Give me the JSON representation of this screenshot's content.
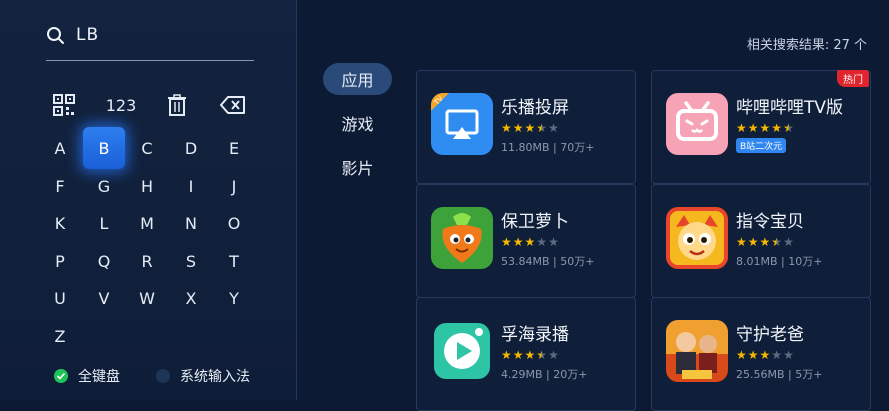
{
  "search": {
    "query": "LB"
  },
  "keyboard": {
    "number_toggle": "123",
    "rows": [
      [
        "A",
        "B",
        "C",
        "D",
        "E"
      ],
      [
        "F",
        "G",
        "H",
        "I",
        "J"
      ],
      [
        "K",
        "L",
        "M",
        "N",
        "O"
      ],
      [
        "P",
        "Q",
        "R",
        "S",
        "T"
      ],
      [
        "U",
        "V",
        "W",
        "X",
        "Y"
      ],
      [
        "Z"
      ]
    ],
    "selected_key": "B",
    "modes": [
      {
        "label": "全键盘",
        "selected": true
      },
      {
        "label": "系统输入法",
        "selected": false
      }
    ]
  },
  "categories": [
    {
      "label": "应用",
      "active": true
    },
    {
      "label": "游戏",
      "active": false
    },
    {
      "label": "影片",
      "active": false
    }
  ],
  "results": {
    "count_text": "相关搜索结果: 27 个"
  },
  "apps": [
    {
      "name": "乐播投屏",
      "rating": 3.5,
      "size": "11.80MB",
      "downloads": "70万+",
      "icon": "lebo-tv-icon"
    },
    {
      "name": "哔哩哔哩TV版",
      "rating": 4.5,
      "tag": "B站二次元",
      "hot": "热门",
      "icon": "bilibili-tv-icon"
    },
    {
      "name": "保卫萝卜",
      "rating": 3,
      "size": "53.84MB",
      "downloads": "50万+",
      "icon": "carrot-game-icon"
    },
    {
      "name": "指令宝贝",
      "rating": 3.5,
      "size": "8.01MB",
      "downloads": "10万+",
      "icon": "baby-mascot-icon"
    },
    {
      "name": "孚海录播",
      "rating": 3.5,
      "size": "4.29MB",
      "downloads": "20万+",
      "icon": "play-button-icon"
    },
    {
      "name": "守护老爸",
      "rating": 3,
      "size": "25.56MB",
      "downloads": "5万+",
      "icon": "movie-poster-icon"
    }
  ],
  "colors": {
    "accent": "#2d7ff0",
    "star": "#f5b800",
    "star_empty": "#5d6b82",
    "hot": "#e0242e",
    "tag": "#2f86f0"
  }
}
